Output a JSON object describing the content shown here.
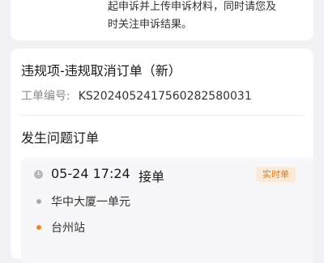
{
  "notice": {
    "line1": "起申诉并上传申诉材料，同时请您及",
    "line2": "时关注申诉结果。"
  },
  "violation": {
    "title": "违规项-违规取消订单（新）",
    "order_no_label": "工单编号:",
    "order_no_value": "KS20240524175602825800​31"
  },
  "order_section": {
    "title": "发生问题订单",
    "time": "05-24 17:24",
    "status": "接单",
    "badge": "实时单",
    "start_address": "华中大厦一单元",
    "end_address": "台州站",
    "icons": {
      "time": "clock-icon",
      "start": "start-dot-icon",
      "end": "end-dot-icon"
    }
  },
  "colors": {
    "background": "#f2f2f4",
    "card": "#ffffff",
    "badge_text": "#d97a1e",
    "badge_bg": "#fbebd6",
    "start_dot": "#a9a9ad",
    "end_dot": "#f08a24"
  }
}
